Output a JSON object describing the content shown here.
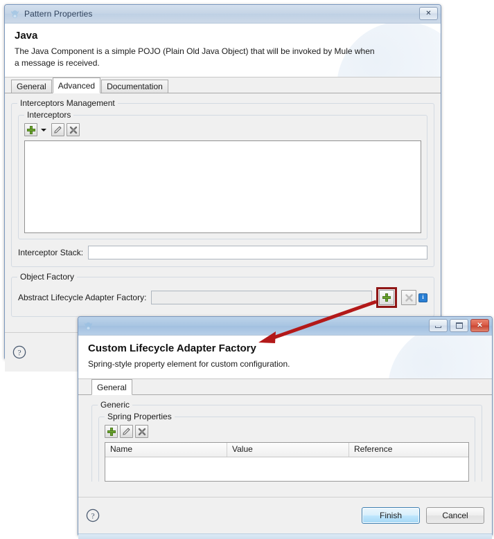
{
  "pattern_properties_dialog": {
    "window_title": "Pattern Properties",
    "logo_icon": "mule-logo-icon",
    "close_button_label": "✕",
    "heading": "Java",
    "description": "The Java Component is a simple POJO (Plain Old Java Object) that will be invoked by Mule when a message is received.",
    "tabs": [
      {
        "label": "General",
        "active": false
      },
      {
        "label": "Advanced",
        "active": true
      },
      {
        "label": "Documentation",
        "active": false
      }
    ],
    "interceptors_management_group": {
      "label": "Interceptors Management",
      "interceptors_group": {
        "label": "Interceptors",
        "toolbar": [
          {
            "icon": "add-plus-icon",
            "label": "Add"
          },
          {
            "icon": "chevron-down-icon",
            "label": "Add options"
          },
          {
            "icon": "edit-pencil-icon",
            "label": "Edit"
          },
          {
            "icon": "delete-icon",
            "label": "Delete"
          }
        ],
        "list_items": []
      },
      "interceptor_stack": {
        "label": "Interceptor Stack:",
        "value": "",
        "placeholder": ""
      }
    },
    "object_factory_group": {
      "label": "Object Factory",
      "abstract_lifecycle_adapter_factory": {
        "label": "Abstract Lifecycle Adapter Factory:",
        "value": "",
        "placeholder": "",
        "add_button_icon": "add-plus-icon",
        "add_button_highlighted": true,
        "clear_button_icon": "clear-x-icon",
        "clear_button_disabled": true,
        "info_badge": "i"
      }
    },
    "footer": {
      "help_icon": "help-question-icon"
    }
  },
  "custom_lifecycle_dialog": {
    "window_title": "",
    "logo_icon": "mule-logo-icon",
    "window_buttons": [
      {
        "name": "minimize-button",
        "glyph": "minimize"
      },
      {
        "name": "maximize-button",
        "glyph": "maximize"
      },
      {
        "name": "close-button",
        "glyph": "✕"
      }
    ],
    "heading": "Custom Lifecycle Adapter Factory",
    "description": "Spring-style property element for custom configuration.",
    "tabs": [
      {
        "label": "General",
        "active": true
      }
    ],
    "generic_group": {
      "label": "Generic",
      "spring_properties_group": {
        "label": "Spring Properties",
        "toolbar": [
          {
            "icon": "add-plus-icon",
            "label": "Add"
          },
          {
            "icon": "edit-pencil-icon",
            "label": "Edit"
          },
          {
            "icon": "delete-icon",
            "label": "Delete"
          }
        ],
        "table": {
          "columns": [
            "Name",
            "Value",
            "Reference"
          ],
          "rows": []
        }
      }
    },
    "footer": {
      "help_icon": "help-question-icon",
      "finish_label": "Finish",
      "cancel_label": "Cancel"
    }
  },
  "annotation": {
    "arrow_color": "#b31919",
    "highlight_color": "#8f1616"
  }
}
